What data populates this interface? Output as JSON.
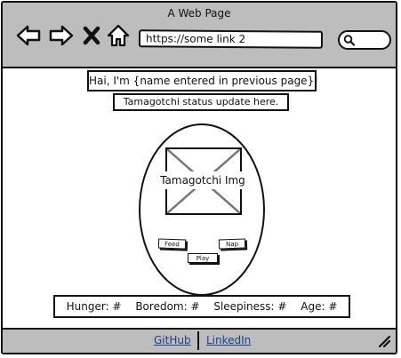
{
  "window": {
    "title": "A Web Page"
  },
  "toolbar": {
    "url": "https://some link 2",
    "icons": [
      "back-arrow-icon",
      "forward-arrow-icon",
      "close-icon",
      "home-icon",
      "search-icon"
    ]
  },
  "page": {
    "greeting": "Hai, I'm {name entered in previous page}!",
    "status": "Tamagotchi status update here.",
    "image_label": "Tamagotchi Img",
    "actions": {
      "feed": "Feed",
      "nap": "Nap",
      "play": "Play"
    },
    "stats": {
      "hunger": "Hunger: #",
      "boredom": "Boredom: #",
      "sleepiness": "Sleepiness: #",
      "age": "Age: #"
    }
  },
  "footer": {
    "github": "GitHub",
    "linkedin": "LinkedIn"
  },
  "colors": {
    "chrome": "#bdbdbd",
    "link": "#1a3f8f",
    "ink": "#111111"
  }
}
